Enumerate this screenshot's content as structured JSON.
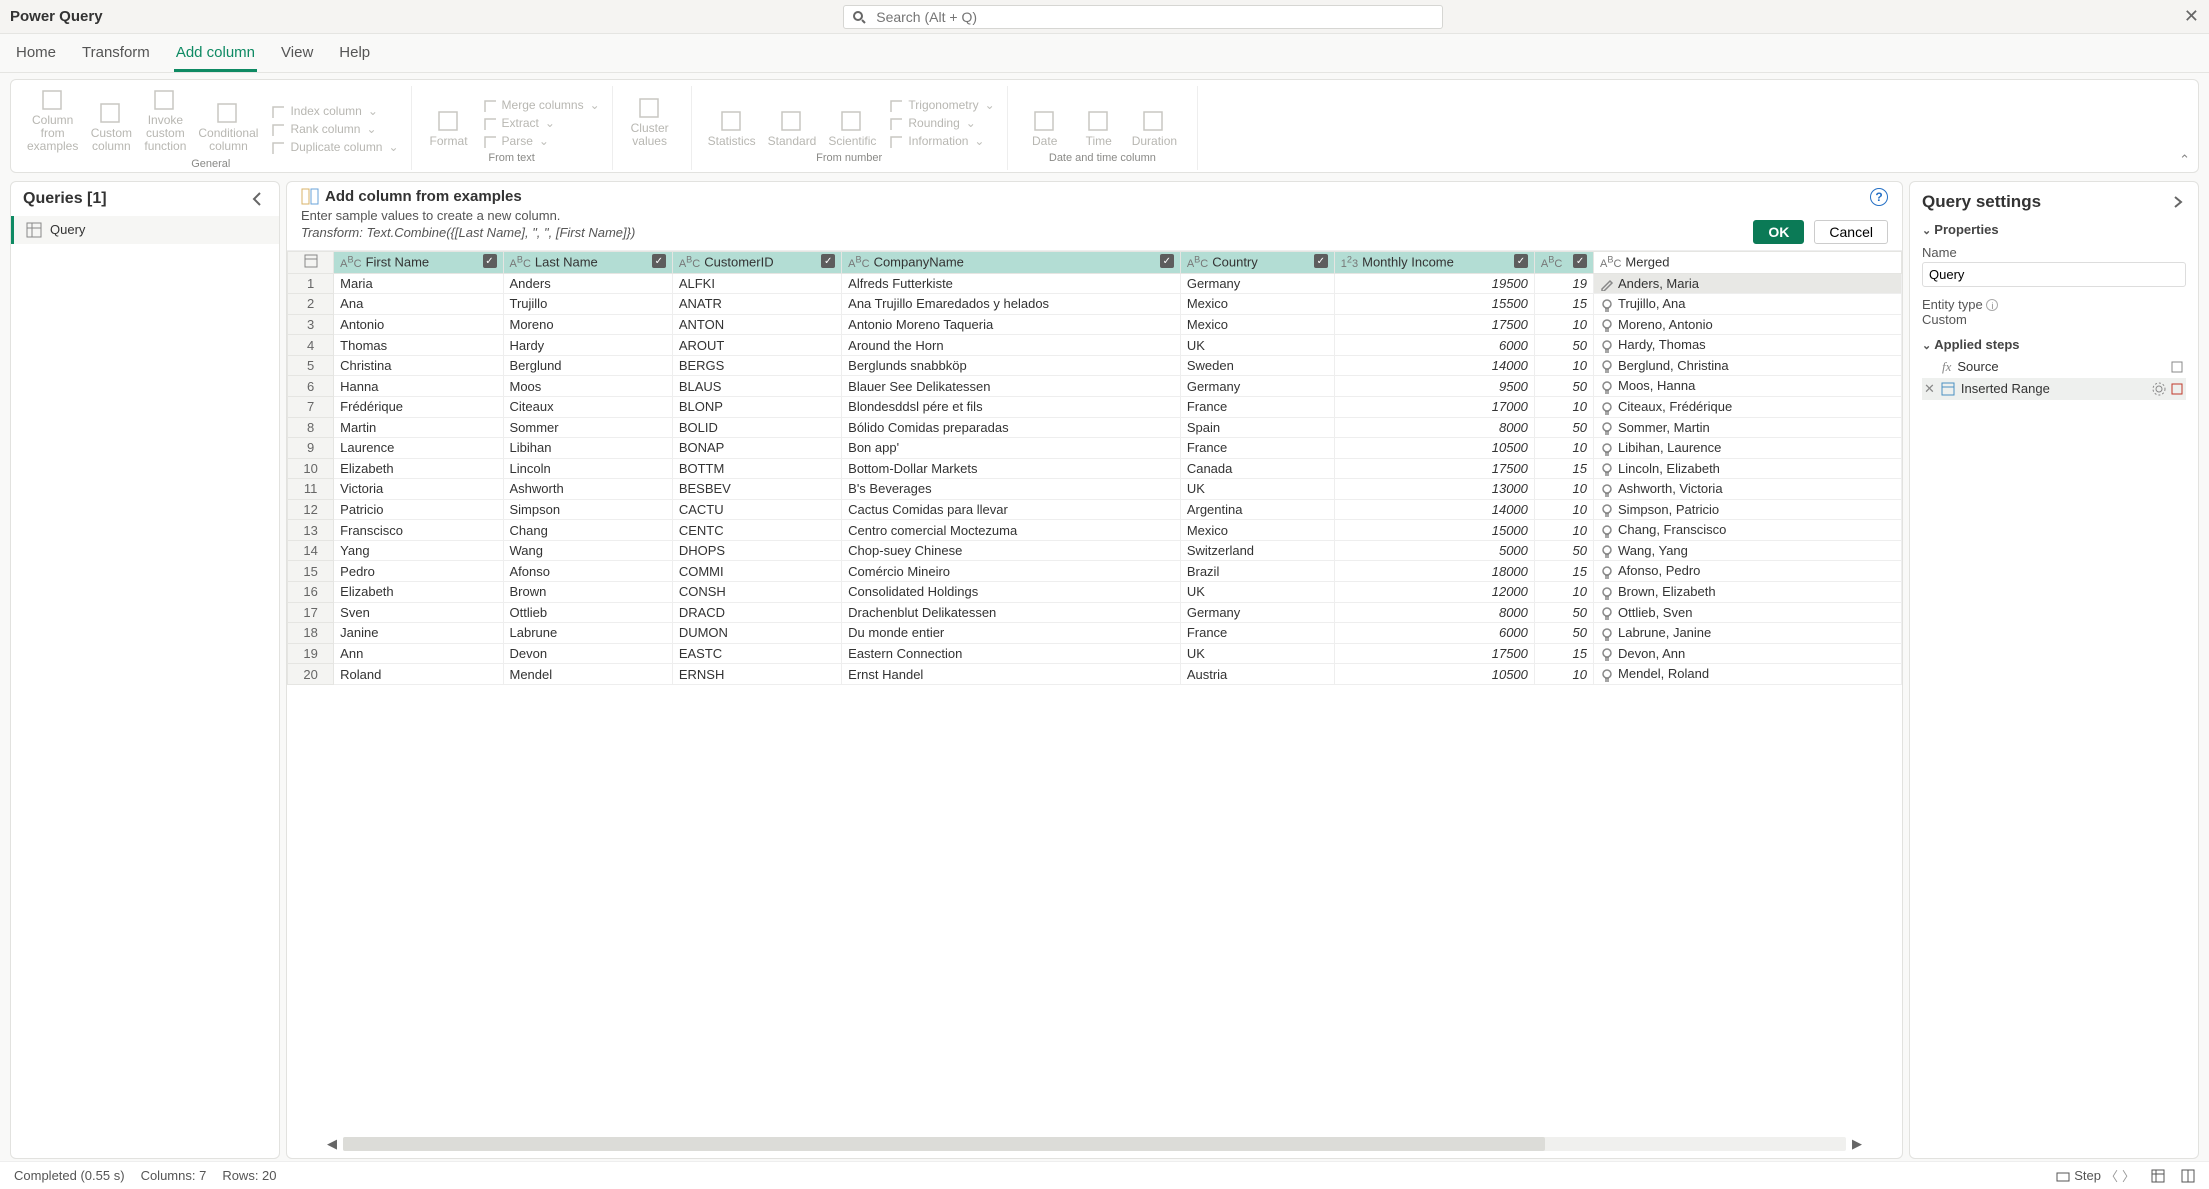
{
  "app": {
    "title": "Power Query",
    "search_placeholder": "Search (Alt + Q)"
  },
  "tabs": [
    "Home",
    "Transform",
    "Add column",
    "View",
    "Help"
  ],
  "active_tab": "Add column",
  "ribbon": {
    "groups": [
      {
        "name": "General",
        "items": [
          "Column from examples",
          "Custom column",
          "Invoke custom function",
          "Conditional column",
          "Index column",
          "Rank column",
          "Duplicate column"
        ]
      },
      {
        "name": "From text",
        "items": [
          "Format",
          "Merge columns",
          "Extract",
          "Parse"
        ]
      },
      {
        "name": "",
        "items": [
          "Cluster values"
        ]
      },
      {
        "name": "From number",
        "items": [
          "Statistics",
          "Standard",
          "Scientific",
          "Trigonometry",
          "Rounding",
          "Information"
        ]
      },
      {
        "name": "Date and time column",
        "items": [
          "Date",
          "Time",
          "Duration"
        ]
      }
    ]
  },
  "queries_panel": {
    "title": "Queries [1]",
    "items": [
      "Query"
    ]
  },
  "banner": {
    "title": "Add column from examples",
    "sub": "Enter sample values to create a new column.",
    "transform": "Transform: Text.Combine({[Last Name], \", \", [First Name]})",
    "ok": "OK",
    "cancel": "Cancel"
  },
  "columns": [
    "First Name",
    "Last Name",
    "CustomerID",
    "CompanyName",
    "Country",
    "Monthly Income",
    "",
    "Merged"
  ],
  "col_types": [
    "ABC",
    "ABC",
    "ABC",
    "ABC",
    "ABC",
    "123",
    "ABC",
    "ABC"
  ],
  "col_selected": [
    true,
    true,
    true,
    true,
    true,
    true,
    true,
    false
  ],
  "rows": [
    {
      "n": 1,
      "fn": "Maria",
      "ln": "Anders",
      "cid": "ALFKI",
      "co": "Alfreds Futterkiste",
      "ct": "Germany",
      "inc": "19500",
      "x": "19",
      "m": "Anders, Maria",
      "pen": true
    },
    {
      "n": 2,
      "fn": "Ana",
      "ln": "Trujillo",
      "cid": "ANATR",
      "co": "Ana Trujillo Emaredados y helados",
      "ct": "Mexico",
      "inc": "15500",
      "x": "15",
      "m": "Trujillo, Ana"
    },
    {
      "n": 3,
      "fn": "Antonio",
      "ln": "Moreno",
      "cid": "ANTON",
      "co": "Antonio Moreno Taqueria",
      "ct": "Mexico",
      "inc": "17500",
      "x": "10",
      "m": "Moreno, Antonio"
    },
    {
      "n": 4,
      "fn": "Thomas",
      "ln": "Hardy",
      "cid": "AROUT",
      "co": "Around the Horn",
      "ct": "UK",
      "inc": "6000",
      "x": "50",
      "m": "Hardy, Thomas"
    },
    {
      "n": 5,
      "fn": "Christina",
      "ln": "Berglund",
      "cid": "BERGS",
      "co": "Berglunds snabbköp",
      "ct": "Sweden",
      "inc": "14000",
      "x": "10",
      "m": "Berglund, Christina"
    },
    {
      "n": 6,
      "fn": "Hanna",
      "ln": "Moos",
      "cid": "BLAUS",
      "co": "Blauer See Delikatessen",
      "ct": "Germany",
      "inc": "9500",
      "x": "50",
      "m": "Moos, Hanna"
    },
    {
      "n": 7,
      "fn": "Frédérique",
      "ln": "Citeaux",
      "cid": "BLONP",
      "co": "Blondesddsl pére et fils",
      "ct": "France",
      "inc": "17000",
      "x": "10",
      "m": "Citeaux, Frédérique"
    },
    {
      "n": 8,
      "fn": "Martin",
      "ln": "Sommer",
      "cid": "BOLID",
      "co": "Bólido Comidas preparadas",
      "ct": "Spain",
      "inc": "8000",
      "x": "50",
      "m": "Sommer, Martin"
    },
    {
      "n": 9,
      "fn": "Laurence",
      "ln": "Libihan",
      "cid": "BONAP",
      "co": "Bon app'",
      "ct": "France",
      "inc": "10500",
      "x": "10",
      "m": "Libihan, Laurence"
    },
    {
      "n": 10,
      "fn": "Elizabeth",
      "ln": "Lincoln",
      "cid": "BOTTM",
      "co": "Bottom-Dollar Markets",
      "ct": "Canada",
      "inc": "17500",
      "x": "15",
      "m": "Lincoln, Elizabeth"
    },
    {
      "n": 11,
      "fn": "Victoria",
      "ln": "Ashworth",
      "cid": "BESBEV",
      "co": "B's Beverages",
      "ct": "UK",
      "inc": "13000",
      "x": "10",
      "m": "Ashworth, Victoria"
    },
    {
      "n": 12,
      "fn": "Patricio",
      "ln": "Simpson",
      "cid": "CACTU",
      "co": "Cactus Comidas para llevar",
      "ct": "Argentina",
      "inc": "14000",
      "x": "10",
      "m": "Simpson, Patricio"
    },
    {
      "n": 13,
      "fn": "Franscisco",
      "ln": "Chang",
      "cid": "CENTC",
      "co": "Centro comercial Moctezuma",
      "ct": "Mexico",
      "inc": "15000",
      "x": "10",
      "m": "Chang, Franscisco"
    },
    {
      "n": 14,
      "fn": "Yang",
      "ln": "Wang",
      "cid": "DHOPS",
      "co": "Chop-suey Chinese",
      "ct": "Switzerland",
      "inc": "5000",
      "x": "50",
      "m": "Wang, Yang"
    },
    {
      "n": 15,
      "fn": "Pedro",
      "ln": "Afonso",
      "cid": "COMMI",
      "co": "Comércio Mineiro",
      "ct": "Brazil",
      "inc": "18000",
      "x": "15",
      "m": "Afonso, Pedro"
    },
    {
      "n": 16,
      "fn": "Elizabeth",
      "ln": "Brown",
      "cid": "CONSH",
      "co": "Consolidated Holdings",
      "ct": "UK",
      "inc": "12000",
      "x": "10",
      "m": "Brown, Elizabeth"
    },
    {
      "n": 17,
      "fn": "Sven",
      "ln": "Ottlieb",
      "cid": "DRACD",
      "co": "Drachenblut Delikatessen",
      "ct": "Germany",
      "inc": "8000",
      "x": "50",
      "m": "Ottlieb, Sven"
    },
    {
      "n": 18,
      "fn": "Janine",
      "ln": "Labrune",
      "cid": "DUMON",
      "co": "Du monde entier",
      "ct": "France",
      "inc": "6000",
      "x": "50",
      "m": "Labrune, Janine"
    },
    {
      "n": 19,
      "fn": "Ann",
      "ln": "Devon",
      "cid": "EASTC",
      "co": "Eastern Connection",
      "ct": "UK",
      "inc": "17500",
      "x": "15",
      "m": "Devon, Ann"
    },
    {
      "n": 20,
      "fn": "Roland",
      "ln": "Mendel",
      "cid": "ERNSH",
      "co": "Ernst Handel",
      "ct": "Austria",
      "inc": "10500",
      "x": "10",
      "m": "Mendel, Roland"
    }
  ],
  "settings": {
    "title": "Query settings",
    "properties": "Properties",
    "name_lbl": "Name",
    "name_val": "Query",
    "entity_lbl": "Entity type",
    "entity_val": "Custom",
    "applied": "Applied steps",
    "steps": [
      "Source",
      "Inserted Range"
    ]
  },
  "status": {
    "completed": "Completed (0.55 s)",
    "columns": "Columns: 7",
    "rows": "Rows: 20",
    "step": "Step"
  }
}
